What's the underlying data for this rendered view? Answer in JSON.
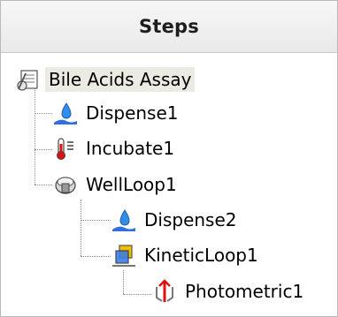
{
  "panel": {
    "title": "Steps"
  },
  "tree": {
    "root": {
      "label": "Bile Acids Assay",
      "icon": "assay-method-icon",
      "selected": true
    },
    "nodes": [
      {
        "key": "dispense1",
        "label": "Dispense1",
        "icon": "dispense-icon",
        "depth": 1
      },
      {
        "key": "incubate1",
        "label": "Incubate1",
        "icon": "thermometer-icon",
        "depth": 1
      },
      {
        "key": "wellloop1",
        "label": "WellLoop1",
        "icon": "well-loop-icon",
        "depth": 1
      },
      {
        "key": "dispense2",
        "label": "Dispense2",
        "icon": "dispense-icon",
        "depth": 2
      },
      {
        "key": "kineticloop1",
        "label": "KineticLoop1",
        "icon": "kinetic-loop-icon",
        "depth": 2
      },
      {
        "key": "photometric1",
        "label": "Photometric1",
        "icon": "photometric-icon",
        "depth": 3
      }
    ]
  },
  "colors": {
    "selected_bg": "#ecebe3",
    "connector": "#8a8a8a",
    "header_border": "#c9c9c9"
  }
}
